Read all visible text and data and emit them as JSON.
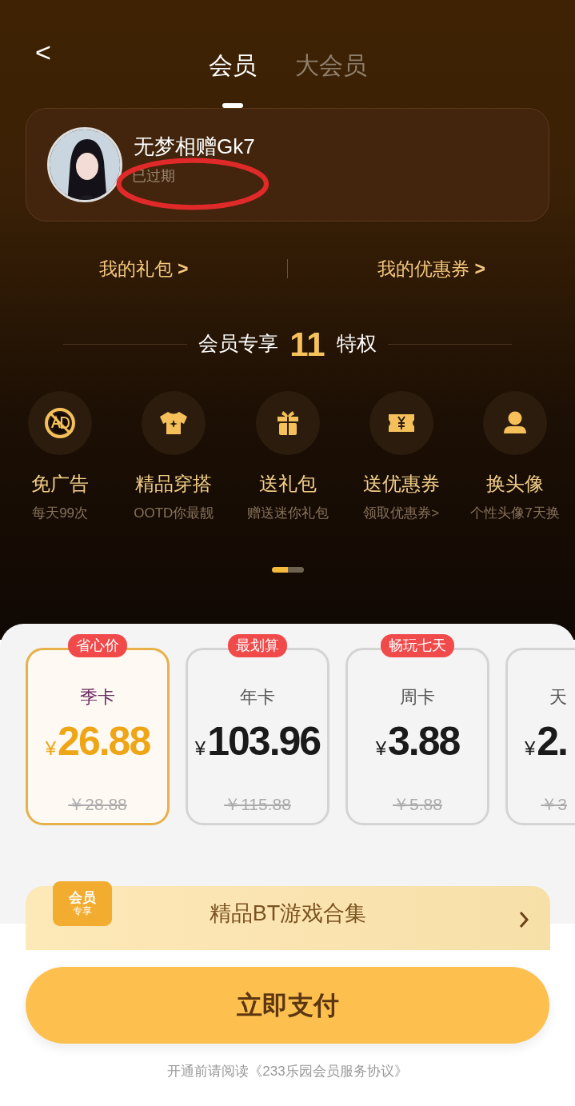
{
  "nav": {
    "back": "<",
    "tabs": [
      {
        "label": "会员",
        "selected": true
      },
      {
        "label": "大会员",
        "selected": false
      }
    ]
  },
  "user": {
    "name": "无梦相赠Gk7",
    "status": "已过期",
    "status_circled": true
  },
  "links": [
    {
      "label": "我的礼包",
      "arrow": ">"
    },
    {
      "label": "我的优惠券",
      "arrow": ">"
    }
  ],
  "perks_title": {
    "before": "会员专享",
    "count": "11",
    "after": "特权"
  },
  "perks": [
    {
      "kind": "noad",
      "label": "免广告",
      "sub": "每天99次"
    },
    {
      "kind": "outfit",
      "label": "精品穿搭",
      "sub": "OOTD你最靓"
    },
    {
      "kind": "gift",
      "label": "送礼包",
      "sub": "赠送迷你礼包"
    },
    {
      "kind": "coupon",
      "label": "送优惠券",
      "sub": "领取优惠券>"
    },
    {
      "kind": "avatar",
      "label": "换头像",
      "sub": "个性头像7天换"
    }
  ],
  "pager": [
    {
      "selected": true
    },
    {
      "selected": false
    }
  ],
  "plans": [
    {
      "tag": "省心价",
      "name": "季卡",
      "currency": "¥",
      "price": "26.88",
      "original": "￥28.88",
      "selected": true
    },
    {
      "tag": "最划算",
      "name": "年卡",
      "currency": "¥",
      "price": "103.96",
      "original": "￥115.88",
      "selected": false
    },
    {
      "tag": "畅玩七天",
      "name": "周卡",
      "currency": "¥",
      "price": "3.88",
      "original": "￥5.88",
      "selected": false
    },
    {
      "name": "天",
      "currency": "¥",
      "price": "2.",
      "original": "￥3",
      "selected": false
    }
  ],
  "banner": {
    "badge_top": "会员",
    "badge_bottom": "专享",
    "title": "精品BT游戏合集"
  },
  "pay_button": "立即支付",
  "agreement": "开通前请阅读《233乐园会员服务协议》"
}
